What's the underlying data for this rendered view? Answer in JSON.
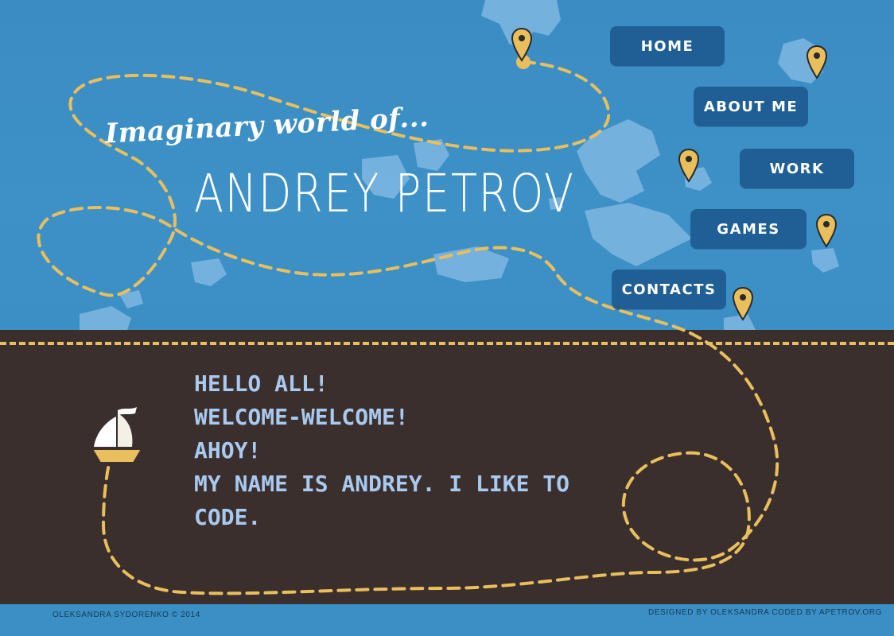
{
  "header": {
    "tagline": "Imaginary world of...",
    "name": "ANDREY PETROV"
  },
  "nav": {
    "home": "HOME",
    "about": "ABOUT ME",
    "work": "WORK",
    "games": "GAMES",
    "contacts": "CONTACTS"
  },
  "intro": {
    "lines": [
      "HELLO ALL!",
      "WELCOME-WELCOME!",
      "AHOY!",
      "MY NAME IS ANDREY. I LIKE TO",
      "CODE."
    ]
  },
  "footer": {
    "copyright": "OLEKSANDRA SYDORENKO © 2014",
    "credits": "DESIGNED BY OLEKSANDRA CODED BY APETROV.ORG"
  },
  "colors": {
    "sky": "#3b8cc2",
    "band": "#3a2f2c",
    "route": "#e9bf5d",
    "button": "#1f5f95",
    "greeting": "#a9c9ef"
  },
  "icons": [
    "map-pin-icon",
    "ship-icon",
    "island-shape"
  ]
}
